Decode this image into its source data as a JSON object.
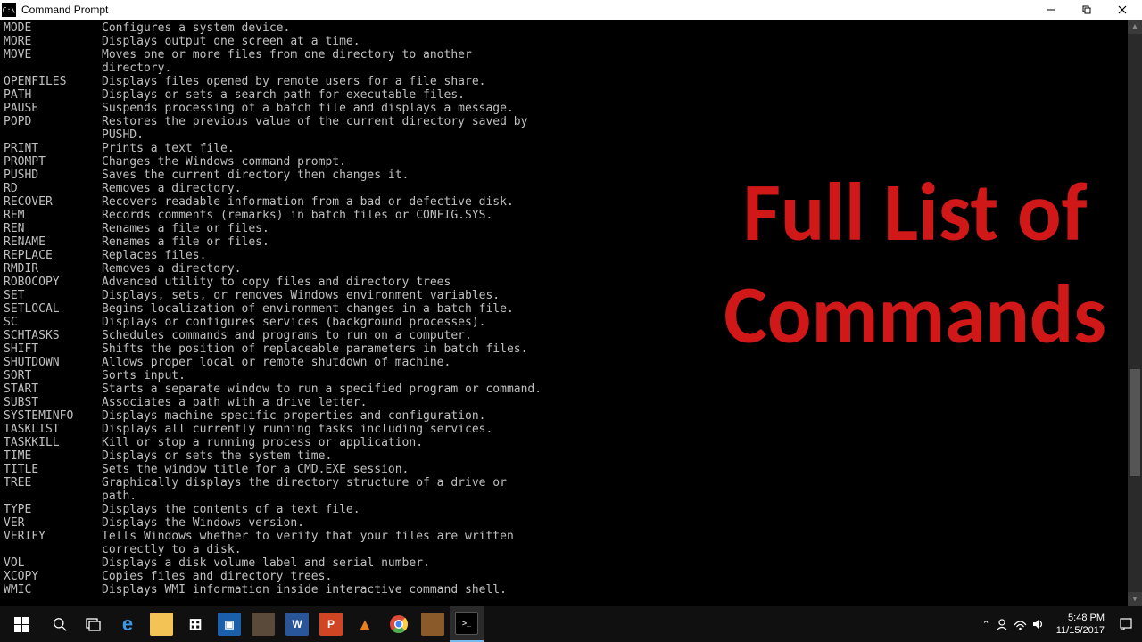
{
  "window": {
    "title": "Command Prompt",
    "icon_label": "C:\\"
  },
  "overlay": {
    "line1": "Full List of",
    "line2": "Commands"
  },
  "commands": [
    {
      "name": "MODE",
      "desc": "Configures a system device."
    },
    {
      "name": "MORE",
      "desc": "Displays output one screen at a time."
    },
    {
      "name": "MOVE",
      "desc": "Moves one or more files from one directory to another directory."
    },
    {
      "name": "OPENFILES",
      "desc": "Displays files opened by remote users for a file share."
    },
    {
      "name": "PATH",
      "desc": "Displays or sets a search path for executable files."
    },
    {
      "name": "PAUSE",
      "desc": "Suspends processing of a batch file and displays a message."
    },
    {
      "name": "POPD",
      "desc": "Restores the previous value of the current directory saved by PUSHD."
    },
    {
      "name": "PRINT",
      "desc": "Prints a text file."
    },
    {
      "name": "PROMPT",
      "desc": "Changes the Windows command prompt."
    },
    {
      "name": "PUSHD",
      "desc": "Saves the current directory then changes it."
    },
    {
      "name": "RD",
      "desc": "Removes a directory."
    },
    {
      "name": "RECOVER",
      "desc": "Recovers readable information from a bad or defective disk."
    },
    {
      "name": "REM",
      "desc": "Records comments (remarks) in batch files or CONFIG.SYS."
    },
    {
      "name": "REN",
      "desc": "Renames a file or files."
    },
    {
      "name": "RENAME",
      "desc": "Renames a file or files."
    },
    {
      "name": "REPLACE",
      "desc": "Replaces files."
    },
    {
      "name": "RMDIR",
      "desc": "Removes a directory."
    },
    {
      "name": "ROBOCOPY",
      "desc": "Advanced utility to copy files and directory trees"
    },
    {
      "name": "SET",
      "desc": "Displays, sets, or removes Windows environment variables."
    },
    {
      "name": "SETLOCAL",
      "desc": "Begins localization of environment changes in a batch file."
    },
    {
      "name": "SC",
      "desc": "Displays or configures services (background processes)."
    },
    {
      "name": "SCHTASKS",
      "desc": "Schedules commands and programs to run on a computer."
    },
    {
      "name": "SHIFT",
      "desc": "Shifts the position of replaceable parameters in batch files."
    },
    {
      "name": "SHUTDOWN",
      "desc": "Allows proper local or remote shutdown of machine."
    },
    {
      "name": "SORT",
      "desc": "Sorts input."
    },
    {
      "name": "START",
      "desc": "Starts a separate window to run a specified program or command."
    },
    {
      "name": "SUBST",
      "desc": "Associates a path with a drive letter."
    },
    {
      "name": "SYSTEMINFO",
      "desc": "Displays machine specific properties and configuration."
    },
    {
      "name": "TASKLIST",
      "desc": "Displays all currently running tasks including services."
    },
    {
      "name": "TASKKILL",
      "desc": "Kill or stop a running process or application."
    },
    {
      "name": "TIME",
      "desc": "Displays or sets the system time."
    },
    {
      "name": "TITLE",
      "desc": "Sets the window title for a CMD.EXE session."
    },
    {
      "name": "TREE",
      "desc": "Graphically displays the directory structure of a drive or path."
    },
    {
      "name": "TYPE",
      "desc": "Displays the contents of a text file."
    },
    {
      "name": "VER",
      "desc": "Displays the Windows version."
    },
    {
      "name": "VERIFY",
      "desc": "Tells Windows whether to verify that your files are written correctly to a disk."
    },
    {
      "name": "VOL",
      "desc": "Displays a disk volume label and serial number."
    },
    {
      "name": "XCOPY",
      "desc": "Copies files and directory trees."
    },
    {
      "name": "WMIC",
      "desc": "Displays WMI information inside interactive command shell."
    }
  ],
  "taskbar": {
    "time": "5:48 PM",
    "date": "11/15/2017"
  }
}
